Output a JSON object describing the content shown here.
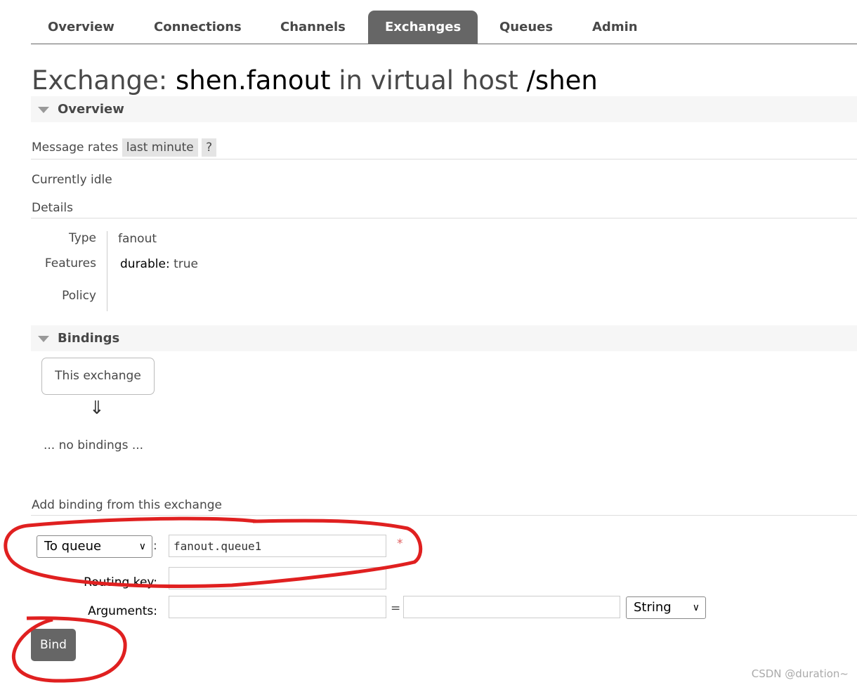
{
  "nav": {
    "tabs": [
      {
        "label": "Overview"
      },
      {
        "label": "Connections"
      },
      {
        "label": "Channels"
      },
      {
        "label": "Exchanges",
        "active": true
      },
      {
        "label": "Queues"
      },
      {
        "label": "Admin"
      }
    ]
  },
  "title": {
    "prefix": "Exchange:",
    "name": "shen.fanout",
    "middle": "in virtual host",
    "vhost": "/shen"
  },
  "overview": {
    "heading": "Overview",
    "message_rates_label": "Message rates",
    "range": "last minute",
    "help": "?",
    "status": "Currently idle",
    "details_label": "Details",
    "type_label": "Type",
    "type_value": "fanout",
    "features_label": "Features",
    "feature_key": "durable:",
    "feature_value": "true",
    "policy_label": "Policy"
  },
  "bindings": {
    "heading": "Bindings",
    "this_exchange": "This exchange",
    "arrow": "⇓",
    "empty": "... no bindings ..."
  },
  "add_binding": {
    "heading": "Add binding from this exchange",
    "destination_type": "To queue",
    "colon": ":",
    "destination_value": "fanout.queue1",
    "required": "*",
    "routing_key_label": "Routing key:",
    "routing_key_value": "",
    "arguments_label": "Arguments:",
    "arg_key": "",
    "equals": "=",
    "arg_value": "",
    "arg_type": "String",
    "bind_label": "Bind"
  },
  "watermark": "CSDN @duration~",
  "colors": {
    "tab_active": "#666666",
    "annotation": "#e02020",
    "required": "#e06060"
  }
}
